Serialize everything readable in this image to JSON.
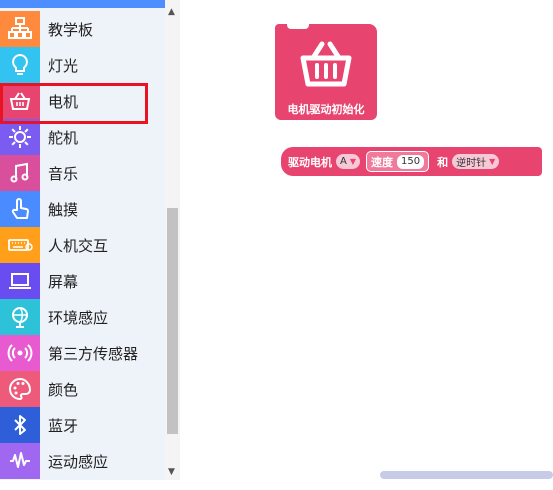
{
  "sidebar": {
    "items": [
      {
        "label": "教学板",
        "icon": "network-tree-icon",
        "color": "#ff8a3d"
      },
      {
        "label": "灯光",
        "icon": "lightbulb-icon",
        "color": "#33c3f0"
      },
      {
        "label": "电机",
        "icon": "basket-icon",
        "color": "#e84470"
      },
      {
        "label": "舵机",
        "icon": "gear-icon",
        "color": "#7b5cf0"
      },
      {
        "label": "音乐",
        "icon": "music-note-icon",
        "color": "#d94f9b"
      },
      {
        "label": "触摸",
        "icon": "hand-pointer-icon",
        "color": "#4a8cff"
      },
      {
        "label": "人机交互",
        "icon": "keyboard-icon",
        "color": "#ff9f1a"
      },
      {
        "label": "屏幕",
        "icon": "laptop-icon",
        "color": "#6a4df0"
      },
      {
        "label": "环境感应",
        "icon": "globe-icon",
        "color": "#2ec2d8"
      },
      {
        "label": "第三方传感器",
        "icon": "sensor-waves-icon",
        "color": "#e85bd0"
      },
      {
        "label": "颜色",
        "icon": "palette-icon",
        "color": "#ee5a7a"
      },
      {
        "label": "蓝牙",
        "icon": "bluetooth-icon",
        "color": "#2f5fd8"
      },
      {
        "label": "运动感应",
        "icon": "motion-wave-icon",
        "color": "#a068f0"
      }
    ]
  },
  "workspace": {
    "init_block": {
      "label": "电机驱动初始化",
      "icon": "basket-icon"
    },
    "drive_block": {
      "label": "驱动电机",
      "motor": "A",
      "speed_label": "速度",
      "speed_value": "150",
      "and_label": "和",
      "direction": "逆时针"
    }
  },
  "colors": {
    "block_pink": "#e84470",
    "highlight_red": "#e81424",
    "sidebar_bg": "#eef3f9"
  }
}
